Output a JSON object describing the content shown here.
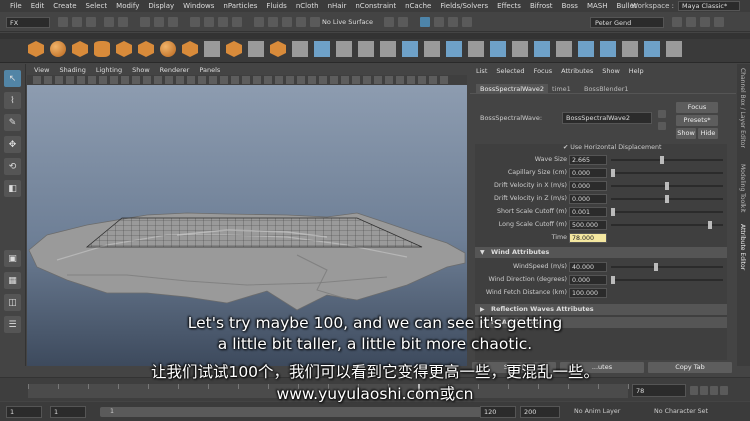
{
  "menubar": {
    "items": [
      "File",
      "Edit",
      "Create",
      "Select",
      "Modify",
      "Display",
      "Windows",
      "nParticles",
      "Fluids",
      "nCloth",
      "nHair",
      "nConstraint",
      "nCache",
      "Fields/Solvers",
      "Effects",
      "Bifrost",
      "Boss",
      "MASH",
      "Bullet"
    ],
    "workspace_label": "Workspace :",
    "workspace_value": "Maya Classic*"
  },
  "statusline": {
    "mode": "FX",
    "live_surface": "No Live Surface",
    "user": "Peter Gend"
  },
  "viewport": {
    "menu": [
      "View",
      "Shading",
      "Lighting",
      "Show",
      "Renderer",
      "Panels"
    ]
  },
  "attribute_editor": {
    "menu": [
      "List",
      "Selected",
      "Focus",
      "Attributes",
      "Show",
      "Help"
    ],
    "tabs": [
      "BossSpectralWave2",
      "time1",
      "BossBlender1"
    ],
    "node_label": "BossSpectralWave:",
    "node_value": "BossSpectralWave2",
    "focus_label": "Focus",
    "presets_label": "Presets*",
    "show_label": "Show",
    "hide_label": "Hide",
    "horiz_disp_label": "Use Horizontal Displacement",
    "rows": [
      {
        "label": "Wave Size",
        "value": "2.665",
        "level": 0.45
      },
      {
        "label": "Capillary Size (cm)",
        "value": "0.000",
        "level": 0.0
      },
      {
        "label": "Drift Velocity in X (m/s)",
        "value": "0.000",
        "level": 0.5
      },
      {
        "label": "Drift Velocity in Z (m/s)",
        "value": "0.000",
        "level": 0.5
      },
      {
        "label": "Short Scale Cutoff (m)",
        "value": "0.001",
        "level": 0.0
      },
      {
        "label": "Long Scale Cutoff (m)",
        "value": "500.000",
        "level": 0.9
      },
      {
        "label": "Time",
        "value": "78.000",
        "level": null
      }
    ],
    "wind_section": "Wind Attributes",
    "wind_rows": [
      {
        "label": "WindSpeed (m/s)",
        "value": "40.000",
        "level": 0.4
      },
      {
        "label": "Wind Direction (degrees)",
        "value": "0.000",
        "level": 0.0
      },
      {
        "label": "Wind Fetch Distance (km)",
        "value": "100.000",
        "level": null
      }
    ],
    "reflection_section": "Reflection Waves Attributes",
    "next_section": "F...Attributes",
    "bottom_buttons": [
      "Select",
      "...utes",
      "Copy Tab"
    ]
  },
  "side_tabs": [
    "Channel Box / Layer Editor",
    "Modeling Toolkit",
    "Attribute Editor"
  ],
  "timeline": {
    "current_frame": "78"
  },
  "range": {
    "start": "1",
    "anim_start": "1",
    "slider_start": "1",
    "slider_end": "120",
    "anim_end": "120",
    "end": "200",
    "anim_layer": "No Anim Layer",
    "char_set": "No Character Set"
  },
  "subtitles": {
    "line1": "Let's try maybe 100, and we can see it's getting",
    "line2": "a little bit taller, a little bit more chaotic.",
    "line3": "让我们试试100个，我们可以看到它变得更高一些，更混乱一些。",
    "line4": "www.yuyulaoshi.com或cn"
  }
}
